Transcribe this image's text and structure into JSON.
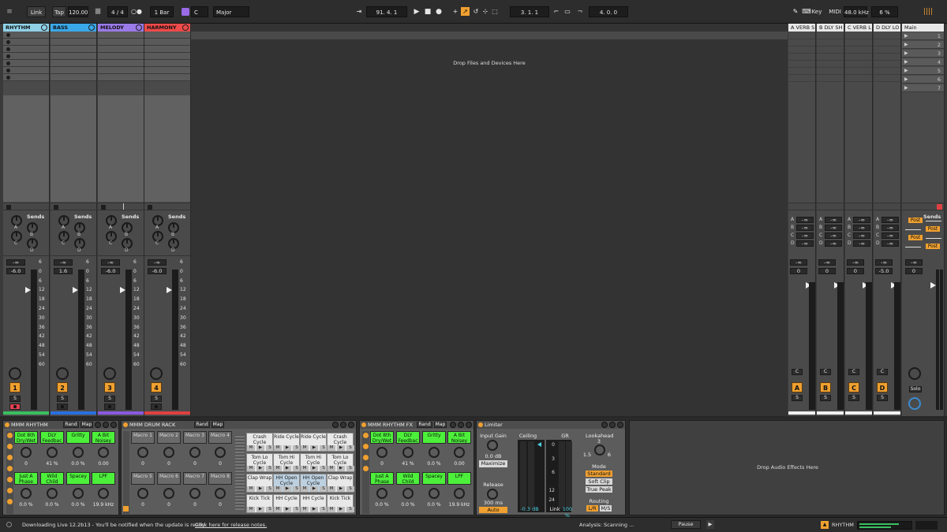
{
  "transport": {
    "link": "Link",
    "tap": "Tap",
    "tempo": "120.00",
    "signature": "4 / 4",
    "quantize": "1 Bar",
    "key_root": "C",
    "scale": "Major",
    "position": "91.  4.  1",
    "loop_start": "3.  1.  1",
    "loop_length": "4.  0.  0",
    "key_label": "Key",
    "midi_label": "MIDI",
    "sample_rate": "48.0 kHz",
    "cpu": "6 %"
  },
  "tracks": [
    {
      "name": "RHYTHM",
      "color": "#8fd0e6",
      "num": "1",
      "volume": "-6.0",
      "strip": "#3ac060"
    },
    {
      "name": "BASS",
      "color": "#3aa8e8",
      "num": "2",
      "volume": "1.6",
      "strip": "#2a70e0"
    },
    {
      "name": "MELODY",
      "color": "#9a7ae8",
      "num": "3",
      "volume": "-6.0",
      "strip": "#8a5ae0"
    },
    {
      "name": "HARMONY",
      "color": "#f04a4a",
      "num": "4",
      "volume": "-6.0",
      "strip": "#e04040"
    }
  ],
  "returns": [
    {
      "name": "A VERB S",
      "letter": "A",
      "volume": "0"
    },
    {
      "name": "B DLY SH",
      "letter": "B",
      "volume": "0"
    },
    {
      "name": "C VERB L",
      "letter": "C",
      "volume": "0"
    },
    {
      "name": "D DLY LO",
      "letter": "D",
      "volume": "-5.0"
    }
  ],
  "master": {
    "name": "Main",
    "scenes": [
      "1",
      "2",
      "3",
      "4",
      "5",
      "6",
      "7"
    ],
    "volume": "0",
    "solo": "Solo",
    "post": "Post"
  },
  "labels": {
    "sends": "Sends",
    "neg_inf": "-∞",
    "send_letters": [
      "A",
      "B",
      "C",
      "D"
    ],
    "s": "S",
    "c": "C",
    "drop_files": "Drop Files and Devices Here",
    "drop_audio": "Drop Audio Effects Here"
  },
  "meter_ticks": [
    "6",
    "0",
    "6",
    "12",
    "18",
    "24",
    "30",
    "36",
    "42",
    "48",
    "54",
    "60"
  ],
  "devices": {
    "rhythm_rack": {
      "title": "MMM RHYTHM",
      "rand": "Rand",
      "map": "Map",
      "macros": [
        {
          "name": "Dot 8th Dry/Wet",
          "value": "0"
        },
        {
          "name": "DLY Feedbac",
          "value": "41 %"
        },
        {
          "name": "Gritty",
          "value": "0.0 %"
        },
        {
          "name": "A Bit Noisey",
          "value": "0.00"
        },
        {
          "name": "Just A Phase",
          "value": "0.0 %"
        },
        {
          "name": "Wild Child",
          "value": "0.0 %"
        },
        {
          "name": "Spacey",
          "value": "0.0 %"
        },
        {
          "name": "LPF",
          "value": "19.9 kHz"
        }
      ]
    },
    "drum_rack": {
      "title": "MMM DRUM RACK",
      "rand": "Rand",
      "map": "Map",
      "macros": [
        {
          "name": "Macro 1",
          "value": "0"
        },
        {
          "name": "Macro 2",
          "value": "0"
        },
        {
          "name": "Macro 3",
          "value": "0"
        },
        {
          "name": "Macro 4",
          "value": "0"
        },
        {
          "name": "Macro 5",
          "value": "0"
        },
        {
          "name": "Macro 6",
          "value": "0"
        },
        {
          "name": "Macro 7",
          "value": "0"
        },
        {
          "name": "Macro 8",
          "value": "0"
        }
      ],
      "pads": [
        "Crash Cycle",
        "Ride Cycle",
        "Ride Cycle",
        "Crash Cycle",
        "Tom Lo Cycle",
        "Tom Hi Cycle",
        "Tom Hi Cycle",
        "Tom Lo Cycle",
        "Clap Wrap",
        "HH Open Cycle",
        "HH Open Cycle",
        "Clap Wrap",
        "Kick Tick",
        "HH Cycle",
        "HH Cycle",
        "Kick Tick"
      ],
      "pad_m": "M",
      "pad_play": "▶",
      "pad_s": "S"
    },
    "rhythm_fx": {
      "title": "MMM RHYTHM FX",
      "rand": "Rand",
      "map": "Map",
      "macros": [
        {
          "name": "Dot 8th Dry/Wet",
          "value": "0"
        },
        {
          "name": "DLY Feedbac",
          "value": "41 %"
        },
        {
          "name": "Gritty",
          "value": "0.0 %"
        },
        {
          "name": "A Bit Noisey",
          "value": "0.00"
        },
        {
          "name": "Just A Phase",
          "value": "0.0 %"
        },
        {
          "name": "Wild Child",
          "value": "0.0 %"
        },
        {
          "name": "Spacey",
          "value": "0.0 %"
        },
        {
          "name": "LPF",
          "value": "19.9 kHz"
        }
      ]
    },
    "limiter": {
      "title": "Limiter",
      "input_gain_label": "Input Gain",
      "input_gain": "0.0 dB",
      "maximize": "Maximize",
      "release_label": "Release",
      "release": "300 ms",
      "auto": "Auto",
      "ceiling_label": "Ceiling",
      "gr_label": "GR",
      "ceiling": "-0.3 dB",
      "link_label": "Link",
      "link": "100 %",
      "gr_ticks": [
        "0",
        "3",
        "6",
        "12",
        "24"
      ],
      "lookahead_label": "Lookahead",
      "lookahead": "3",
      "la_min": "1.5",
      "la_max": "6",
      "mode_label": "Mode",
      "modes": [
        "Standard",
        "Soft Clip",
        "True Peak"
      ],
      "routing_label": "Routing",
      "lr": "L/R",
      "ms": "M/S"
    }
  },
  "status": {
    "message": "Downloading Live 12.2b13 - You'll be notified when the update is ready.",
    "link": "Click here for release notes.",
    "analysis": "Analysis: Scanning ...",
    "pause": "Pause",
    "track": "RHYTHM"
  },
  "colors": {
    "accent": "#f0a030",
    "green_macro": "#4cf03a",
    "panel": "#5c5c5c"
  }
}
